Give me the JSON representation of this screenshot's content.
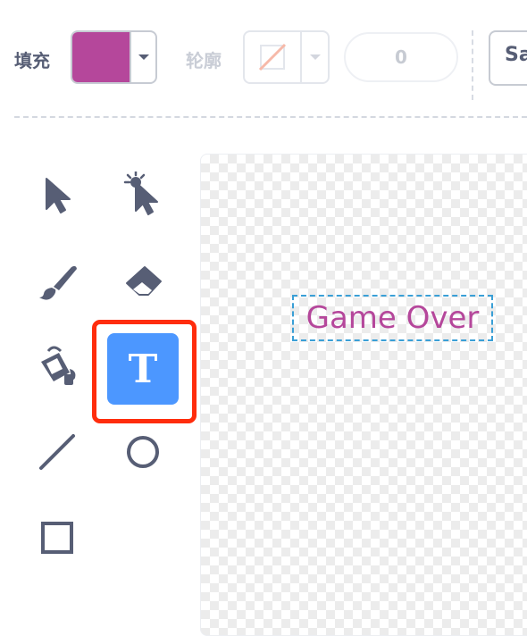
{
  "toolbar": {
    "fill_label": "填充",
    "fill_color": "#b5479b",
    "outline_label": "轮廓",
    "stroke_width": "0",
    "font_value": "Sa"
  },
  "tools": [
    {
      "name": "select",
      "icon": "arrow-pointer-icon"
    },
    {
      "name": "reshape",
      "icon": "reshape-pointer-icon"
    },
    {
      "name": "brush",
      "icon": "brush-icon"
    },
    {
      "name": "eraser",
      "icon": "eraser-icon"
    },
    {
      "name": "fill",
      "icon": "paint-bucket-icon"
    },
    {
      "name": "text",
      "icon": "text-T-icon",
      "glyph": "T",
      "active": true
    },
    {
      "name": "line",
      "icon": "line-icon"
    },
    {
      "name": "circle",
      "icon": "circle-icon"
    },
    {
      "name": "rectangle",
      "icon": "rectangle-icon"
    }
  ],
  "canvas": {
    "text_object": "Game Over",
    "text_color": "#b5479b"
  },
  "colors": {
    "accent": "#4c97ff",
    "icon": "#575e75",
    "highlight": "#ff2d0d"
  }
}
